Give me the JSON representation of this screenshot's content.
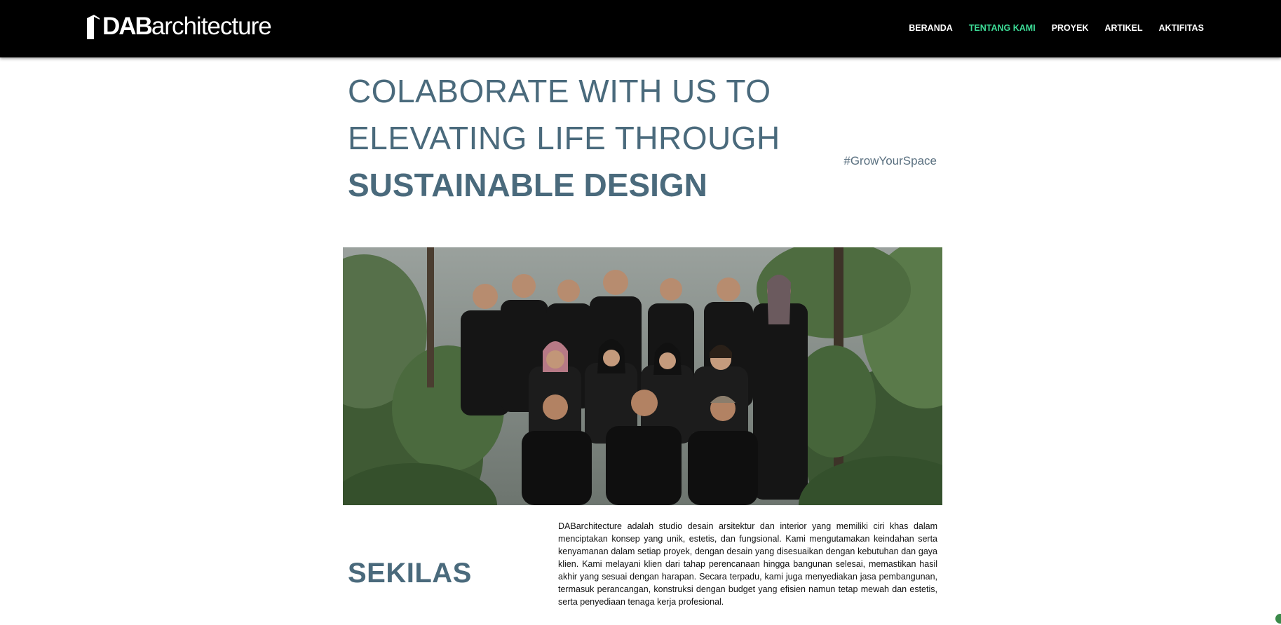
{
  "header": {
    "logo": {
      "part1": "DAB",
      "part2": "architecture"
    },
    "nav": [
      {
        "label": "BERANDA",
        "active": false
      },
      {
        "label": "TENTANG KAMI",
        "active": true
      },
      {
        "label": "PROYEK",
        "active": false
      },
      {
        "label": "ARTIKEL",
        "active": false
      },
      {
        "label": "AKTIFITAS",
        "active": false
      }
    ]
  },
  "hero": {
    "line1": "COLABORATE WITH US TO",
    "line2": "ELEVATING LIFE THROUGH",
    "line3": "SUSTAINABLE DESIGN",
    "hashtag": "#GrowYourSpace"
  },
  "team_photo": {
    "icon": "team-group-photo"
  },
  "overview": {
    "title": "SEKILAS",
    "text": "DABarchitecture adalah studio desain arsitektur dan interior yang memiliki ciri khas dalam menciptakan konsep yang unik, estetis, dan fungsional. Kami mengutamakan keindahan serta kenyamanan dalam setiap proyek, dengan desain yang disesuaikan dengan kebutuhan dan gaya klien. Kami melayani klien dari tahap perencanaan hingga bangunan selesai, memastikan hasil akhir yang sesuai dengan harapan. Secara terpadu, kami juga menyediakan jasa pembangunan, termasuk perancangan, konstruksi dengan budget yang efisien namun tetap mewah dan estetis, serta penyediaan tenaga kerja profesional."
  },
  "colors": {
    "header_bg": "#000000",
    "nav_active": "#3ddc97",
    "heading": "#4a6a7c"
  }
}
